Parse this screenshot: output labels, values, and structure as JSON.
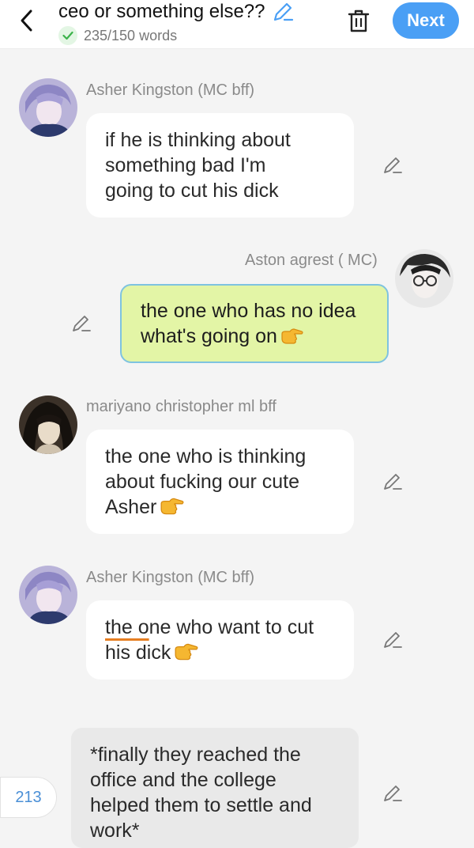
{
  "header": {
    "title": "ceo or something else??",
    "word_count": "235/150 words",
    "next_label": "Next",
    "accent": "#4a9ff5"
  },
  "messages": [
    {
      "name": "Asher Kingston (MC bff)",
      "lines": [
        "if he is thinking about",
        "something bad I'm",
        "going to cut his dick"
      ],
      "side": "left"
    },
    {
      "name": "Aston agrest ( MC)",
      "lines": [
        "the one who has no idea",
        "what's going on"
      ],
      "side": "right",
      "emoji": "pointing-right"
    },
    {
      "name": "mariyano christopher ml bff",
      "lines": [
        "the one who is thinking",
        "about fucking our cute",
        "Asher"
      ],
      "side": "left",
      "emoji": "pointing-right"
    },
    {
      "name": "Asher Kingston (MC bff)",
      "lines": [
        "the one who want to cut",
        "his dick"
      ],
      "underlined": "the o",
      "line1_rest": "ne who want to cut",
      "side": "left",
      "emoji": "pointing-right"
    },
    {
      "type": "narration",
      "lines": [
        "*finally they reached the",
        "office and the college",
        "helped them to settle and",
        "work*"
      ]
    }
  ],
  "page_indicator": "213",
  "icons": [
    "back-chevron-icon",
    "pencil-icon",
    "check-icon",
    "trash-icon",
    "pointing-hand-emoji"
  ]
}
